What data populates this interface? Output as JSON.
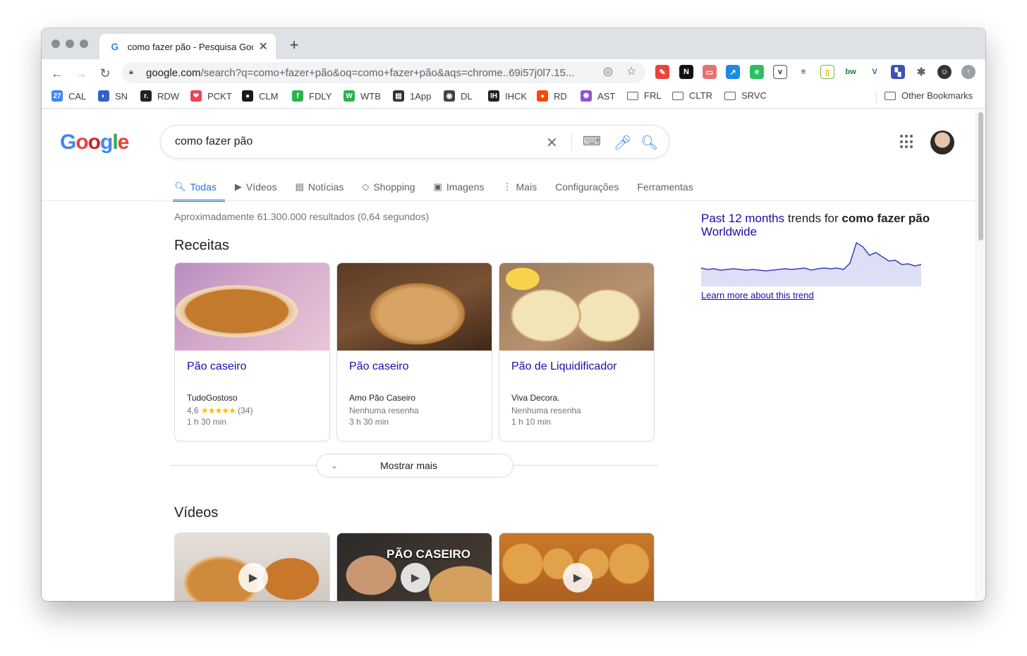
{
  "browser": {
    "tab": {
      "favicon": "G",
      "title": "como fazer pão - Pesquisa Goo"
    },
    "url": {
      "host": "google.com",
      "path": "/search?q=como+fazer+pão&oq=como+fazer+pão&aqs=chrome..69i57j0l7.15..."
    },
    "bookmarks": [
      {
        "label": "CAL",
        "icon": "calendar-icon",
        "color": "#4285f4",
        "glyph": "27"
      },
      {
        "label": "SN",
        "icon": "simplenote-icon",
        "color": "#3361cc",
        "glyph": "◐"
      },
      {
        "label": "RDW",
        "icon": "readwise-icon",
        "color": "#202124",
        "glyph": "r."
      },
      {
        "label": "PCKT",
        "icon": "pocket-icon",
        "color": "#ef4056",
        "glyph": "❤"
      },
      {
        "label": "CLM",
        "icon": "clm-icon",
        "color": "#1a1a1a",
        "glyph": "●"
      },
      {
        "label": "FDLY",
        "icon": "feedly-icon",
        "color": "#2bb24c",
        "glyph": "f"
      },
      {
        "label": "WTB",
        "icon": "wtb-icon",
        "color": "#2bb24c",
        "glyph": "W"
      },
      {
        "label": "1App",
        "icon": "1app-icon",
        "color": "#333333",
        "glyph": "▤"
      },
      {
        "label": "DL",
        "icon": "dl-icon",
        "color": "#444444",
        "glyph": "◉"
      },
      {
        "label": "IHCK",
        "icon": "ihck-icon",
        "color": "#222222",
        "glyph": "IH"
      },
      {
        "label": "RD",
        "icon": "reddit-icon",
        "color": "#ff4500",
        "glyph": "●"
      },
      {
        "label": "AST",
        "icon": "ast-icon",
        "color": "#8a56d6",
        "glyph": "✺"
      }
    ],
    "folders": [
      "FRL",
      "CLTR",
      "SRVC"
    ],
    "other_bookmarks": "Other Bookmarks"
  },
  "search": {
    "query": "como fazer pão",
    "nav_tabs": [
      {
        "label": "Todas",
        "icon": "search-icon",
        "glyph": "🔍︎"
      },
      {
        "label": "Vídeos",
        "icon": "video-icon",
        "glyph": "▶"
      },
      {
        "label": "Notícias",
        "icon": "news-icon",
        "glyph": "▤"
      },
      {
        "label": "Shopping",
        "icon": "tag-icon",
        "glyph": "◇"
      },
      {
        "label": "Imagens",
        "icon": "image-icon",
        "glyph": "▣"
      },
      {
        "label": "Mais",
        "icon": "more-vert-icon",
        "glyph": "⋮"
      },
      {
        "label": "Configurações",
        "icon": "",
        "glyph": ""
      },
      {
        "label": "Ferramentas",
        "icon": "",
        "glyph": ""
      }
    ],
    "stats": "Aproximadamente 61.300.000 resultados (0,64 segundos)",
    "recipes_title": "Receitas",
    "recipes": [
      {
        "title": "Pão caseiro",
        "source": "TudoGostoso",
        "rating": "4,6",
        "stars": "★★★★★",
        "reviews": "(34)",
        "time": "1 h 30 min"
      },
      {
        "title": "Pão caseiro",
        "source": "Amo Pão Caseiro",
        "rating_text": "Nenhuma resenha",
        "time": "3 h 30 min"
      },
      {
        "title": "Pão de Liquidificador",
        "source": "Viva Decora.",
        "rating_text": "Nenhuma resenha",
        "time": "1 h 10 min"
      }
    ],
    "show_more": "Mostrar mais",
    "videos_title": "Vídeos",
    "video_overlay": "PÃO CASEIRO"
  },
  "trends": {
    "highlight": "Past 12 months",
    "mid": "trends for",
    "term": "como fazer pão",
    "region": "Worldwide",
    "link": "Learn more about this trend",
    "series": [
      22,
      20,
      21,
      19,
      20,
      21,
      20,
      19,
      20,
      19,
      18,
      19,
      20,
      21,
      20,
      21,
      22,
      19,
      21,
      22,
      21,
      22,
      20,
      29,
      58,
      52,
      40,
      44,
      38,
      32,
      33,
      27,
      28,
      25,
      27
    ]
  },
  "colors": {
    "accent": "#1a73e8",
    "link": "#1a0dab"
  }
}
